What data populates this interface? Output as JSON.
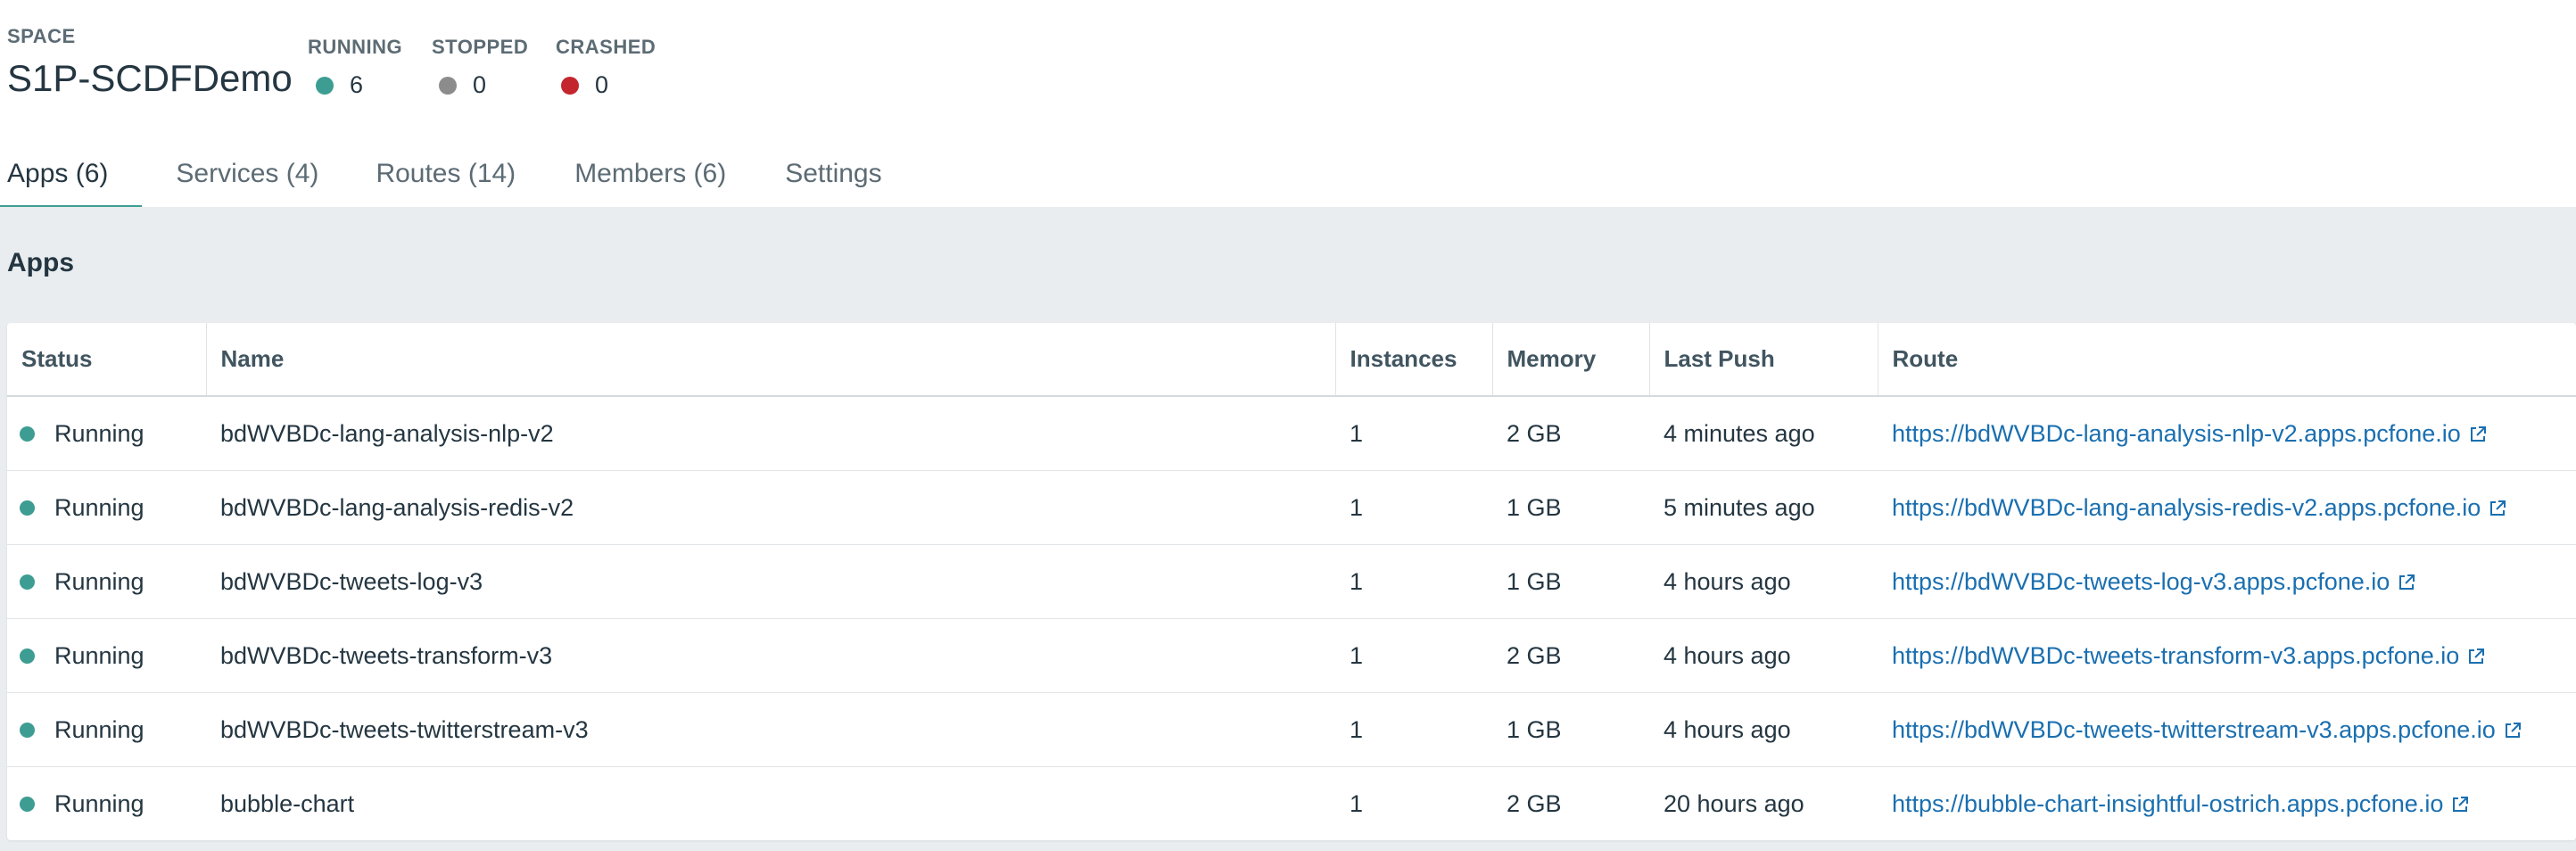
{
  "space": {
    "label": "SPACE",
    "name": "S1P-SCDFDemo"
  },
  "stats": {
    "running": {
      "label": "RUNNING",
      "value": "6",
      "color": "#3d9d93"
    },
    "stopped": {
      "label": "STOPPED",
      "value": "0",
      "color": "#8c8c8c"
    },
    "crashed": {
      "label": "CRASHED",
      "value": "0",
      "color": "#c4262e"
    }
  },
  "tabs": [
    {
      "label": "Apps (6)",
      "active": true
    },
    {
      "label": "Services (4)",
      "active": false
    },
    {
      "label": "Routes (14)",
      "active": false
    },
    {
      "label": "Members (6)",
      "active": false
    },
    {
      "label": "Settings",
      "active": false
    }
  ],
  "section_title": "Apps",
  "table": {
    "columns": [
      "Status",
      "Name",
      "Instances",
      "Memory",
      "Last Push",
      "Route"
    ],
    "rows": [
      {
        "status": "Running",
        "name": "bdWVBDc-lang-analysis-nlp-v2",
        "instances": "1",
        "memory": "2 GB",
        "last_push": "4 minutes ago",
        "route": "https://bdWVBDc-lang-analysis-nlp-v2.apps.pcfone.io"
      },
      {
        "status": "Running",
        "name": "bdWVBDc-lang-analysis-redis-v2",
        "instances": "1",
        "memory": "1 GB",
        "last_push": "5 minutes ago",
        "route": "https://bdWVBDc-lang-analysis-redis-v2.apps.pcfone.io"
      },
      {
        "status": "Running",
        "name": "bdWVBDc-tweets-log-v3",
        "instances": "1",
        "memory": "1 GB",
        "last_push": "4 hours ago",
        "route": "https://bdWVBDc-tweets-log-v3.apps.pcfone.io"
      },
      {
        "status": "Running",
        "name": "bdWVBDc-tweets-transform-v3",
        "instances": "1",
        "memory": "2 GB",
        "last_push": "4 hours ago",
        "route": "https://bdWVBDc-tweets-transform-v3.apps.pcfone.io"
      },
      {
        "status": "Running",
        "name": "bdWVBDc-tweets-twitterstream-v3",
        "instances": "1",
        "memory": "1 GB",
        "last_push": "4 hours ago",
        "route": "https://bdWVBDc-tweets-twitterstream-v3.apps.pcfone.io"
      },
      {
        "status": "Running",
        "name": "bubble-chart",
        "instances": "1",
        "memory": "2 GB",
        "last_push": "20 hours ago",
        "route": "https://bubble-chart-insightful-ostrich.apps.pcfone.io"
      }
    ]
  },
  "colors": {
    "accent": "#3d9d93",
    "link": "#1a6fb0",
    "running_dot": "#3d9d93"
  },
  "icons": {
    "route_link": "external-link-icon",
    "status": "status-dot-icon"
  }
}
